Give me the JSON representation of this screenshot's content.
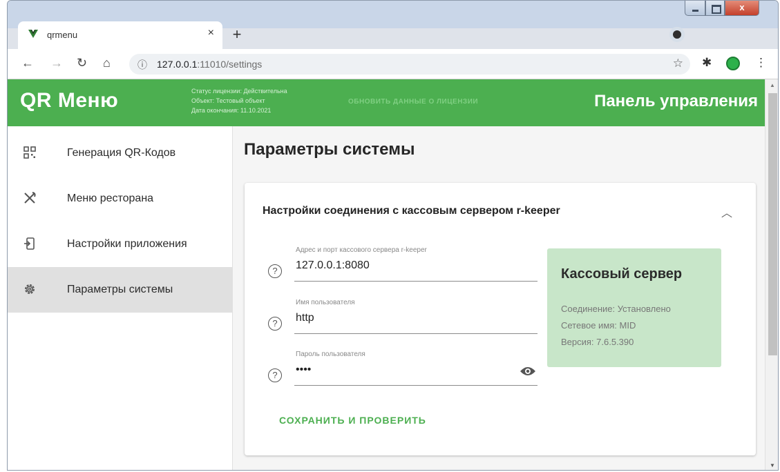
{
  "browser": {
    "tab_title": "qrmenu",
    "tab_close": "×",
    "new_tab": "+",
    "url_host": "127.0.0.1",
    "url_rest": ":11010/settings",
    "window_close": "x"
  },
  "appbar": {
    "brand": "QR Меню",
    "license_status": "Статус лицензии: Действительна",
    "license_object": "Объект: Тестовый объект",
    "license_expiry": "Дата окончания: 11.10.2021",
    "refresh_license": "Обновить данные о лицензии",
    "panel_title": "Панель управления"
  },
  "sidebar": {
    "items": [
      {
        "label": "Генерация QR-Кодов",
        "icon": "qr-code-icon"
      },
      {
        "label": "Меню ресторана",
        "icon": "utensils-icon"
      },
      {
        "label": "Настройки приложения",
        "icon": "app-settings-icon"
      },
      {
        "label": "Параметры системы",
        "icon": "gear-icon",
        "active": true
      }
    ]
  },
  "main": {
    "page_title": "Параметры системы",
    "card_title": "Настройки соединения с кассовым сервером r-keeper",
    "fields": [
      {
        "label": "Адрес и порт кассового сервера r-keeper",
        "value": "127.0.0.1:8080"
      },
      {
        "label": "Имя пользователя",
        "value": "http"
      },
      {
        "label": "Пароль пользователя",
        "value": "••••"
      }
    ],
    "save_button": "СОХРАНИТЬ И ПРОВЕРИТЬ"
  },
  "server": {
    "title": "Кассовый сервер",
    "connection": "Соединение: Установлено",
    "network_name": "Сетевое имя: MID",
    "version": "Версия: 7.6.5.390"
  },
  "colors": {
    "primary": "#4caf50",
    "server_box": "#c8e6c9",
    "active_nav": "#e0e0e0"
  }
}
